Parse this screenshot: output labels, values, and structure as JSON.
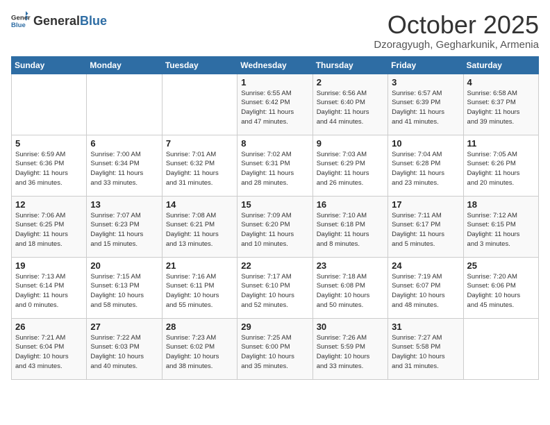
{
  "header": {
    "logo_general": "General",
    "logo_blue": "Blue",
    "title": "October 2025",
    "subtitle": "Dzoragyugh, Gegharkunik, Armenia"
  },
  "weekdays": [
    "Sunday",
    "Monday",
    "Tuesday",
    "Wednesday",
    "Thursday",
    "Friday",
    "Saturday"
  ],
  "weeks": [
    [
      {
        "day": "",
        "info": ""
      },
      {
        "day": "",
        "info": ""
      },
      {
        "day": "",
        "info": ""
      },
      {
        "day": "1",
        "info": "Sunrise: 6:55 AM\nSunset: 6:42 PM\nDaylight: 11 hours\nand 47 minutes."
      },
      {
        "day": "2",
        "info": "Sunrise: 6:56 AM\nSunset: 6:40 PM\nDaylight: 11 hours\nand 44 minutes."
      },
      {
        "day": "3",
        "info": "Sunrise: 6:57 AM\nSunset: 6:39 PM\nDaylight: 11 hours\nand 41 minutes."
      },
      {
        "day": "4",
        "info": "Sunrise: 6:58 AM\nSunset: 6:37 PM\nDaylight: 11 hours\nand 39 minutes."
      }
    ],
    [
      {
        "day": "5",
        "info": "Sunrise: 6:59 AM\nSunset: 6:36 PM\nDaylight: 11 hours\nand 36 minutes."
      },
      {
        "day": "6",
        "info": "Sunrise: 7:00 AM\nSunset: 6:34 PM\nDaylight: 11 hours\nand 33 minutes."
      },
      {
        "day": "7",
        "info": "Sunrise: 7:01 AM\nSunset: 6:32 PM\nDaylight: 11 hours\nand 31 minutes."
      },
      {
        "day": "8",
        "info": "Sunrise: 7:02 AM\nSunset: 6:31 PM\nDaylight: 11 hours\nand 28 minutes."
      },
      {
        "day": "9",
        "info": "Sunrise: 7:03 AM\nSunset: 6:29 PM\nDaylight: 11 hours\nand 26 minutes."
      },
      {
        "day": "10",
        "info": "Sunrise: 7:04 AM\nSunset: 6:28 PM\nDaylight: 11 hours\nand 23 minutes."
      },
      {
        "day": "11",
        "info": "Sunrise: 7:05 AM\nSunset: 6:26 PM\nDaylight: 11 hours\nand 20 minutes."
      }
    ],
    [
      {
        "day": "12",
        "info": "Sunrise: 7:06 AM\nSunset: 6:25 PM\nDaylight: 11 hours\nand 18 minutes."
      },
      {
        "day": "13",
        "info": "Sunrise: 7:07 AM\nSunset: 6:23 PM\nDaylight: 11 hours\nand 15 minutes."
      },
      {
        "day": "14",
        "info": "Sunrise: 7:08 AM\nSunset: 6:21 PM\nDaylight: 11 hours\nand 13 minutes."
      },
      {
        "day": "15",
        "info": "Sunrise: 7:09 AM\nSunset: 6:20 PM\nDaylight: 11 hours\nand 10 minutes."
      },
      {
        "day": "16",
        "info": "Sunrise: 7:10 AM\nSunset: 6:18 PM\nDaylight: 11 hours\nand 8 minutes."
      },
      {
        "day": "17",
        "info": "Sunrise: 7:11 AM\nSunset: 6:17 PM\nDaylight: 11 hours\nand 5 minutes."
      },
      {
        "day": "18",
        "info": "Sunrise: 7:12 AM\nSunset: 6:15 PM\nDaylight: 11 hours\nand 3 minutes."
      }
    ],
    [
      {
        "day": "19",
        "info": "Sunrise: 7:13 AM\nSunset: 6:14 PM\nDaylight: 11 hours\nand 0 minutes."
      },
      {
        "day": "20",
        "info": "Sunrise: 7:15 AM\nSunset: 6:13 PM\nDaylight: 10 hours\nand 58 minutes."
      },
      {
        "day": "21",
        "info": "Sunrise: 7:16 AM\nSunset: 6:11 PM\nDaylight: 10 hours\nand 55 minutes."
      },
      {
        "day": "22",
        "info": "Sunrise: 7:17 AM\nSunset: 6:10 PM\nDaylight: 10 hours\nand 52 minutes."
      },
      {
        "day": "23",
        "info": "Sunrise: 7:18 AM\nSunset: 6:08 PM\nDaylight: 10 hours\nand 50 minutes."
      },
      {
        "day": "24",
        "info": "Sunrise: 7:19 AM\nSunset: 6:07 PM\nDaylight: 10 hours\nand 48 minutes."
      },
      {
        "day": "25",
        "info": "Sunrise: 7:20 AM\nSunset: 6:06 PM\nDaylight: 10 hours\nand 45 minutes."
      }
    ],
    [
      {
        "day": "26",
        "info": "Sunrise: 7:21 AM\nSunset: 6:04 PM\nDaylight: 10 hours\nand 43 minutes."
      },
      {
        "day": "27",
        "info": "Sunrise: 7:22 AM\nSunset: 6:03 PM\nDaylight: 10 hours\nand 40 minutes."
      },
      {
        "day": "28",
        "info": "Sunrise: 7:23 AM\nSunset: 6:02 PM\nDaylight: 10 hours\nand 38 minutes."
      },
      {
        "day": "29",
        "info": "Sunrise: 7:25 AM\nSunset: 6:00 PM\nDaylight: 10 hours\nand 35 minutes."
      },
      {
        "day": "30",
        "info": "Sunrise: 7:26 AM\nSunset: 5:59 PM\nDaylight: 10 hours\nand 33 minutes."
      },
      {
        "day": "31",
        "info": "Sunrise: 7:27 AM\nSunset: 5:58 PM\nDaylight: 10 hours\nand 31 minutes."
      },
      {
        "day": "",
        "info": ""
      }
    ]
  ]
}
